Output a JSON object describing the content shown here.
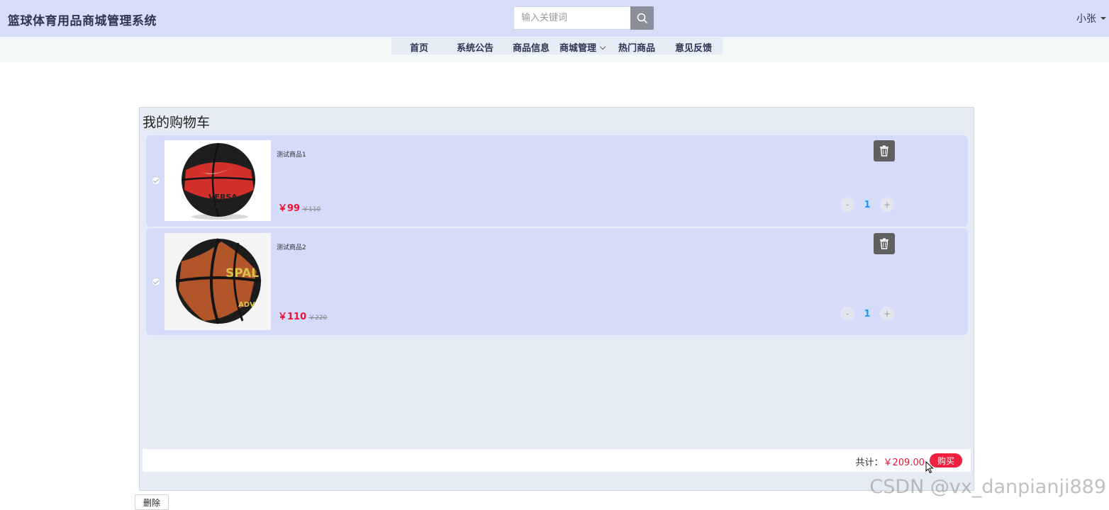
{
  "header": {
    "app_title": "篮球体育用品商城管理系统",
    "search_placeholder": "输入关键词",
    "user_name": "小张"
  },
  "nav": {
    "items": [
      {
        "label": "首页"
      },
      {
        "label": "系统公告"
      },
      {
        "label": "商品信息"
      },
      {
        "label": "商城管理"
      },
      {
        "label": "热门商品"
      },
      {
        "label": "意见反馈"
      }
    ]
  },
  "cart": {
    "title": "我的购物车",
    "items": [
      {
        "name": "测试商品1",
        "price": "￥99",
        "original_price": "￥110",
        "quantity": "1",
        "minus_label": "-",
        "plus_label": "+",
        "image_icon": "basketball-nike-icon",
        "checked": true
      },
      {
        "name": "测试商品2",
        "price": "￥110",
        "original_price": "￥220",
        "quantity": "1",
        "minus_label": "-",
        "plus_label": "+",
        "image_icon": "basketball-spalding-icon",
        "checked": true
      }
    ],
    "total_label": "共计：",
    "total_amount": "￥209.00",
    "buy_label": "购买"
  },
  "footer": {
    "delete_label": "删除"
  },
  "watermark": "CSDN @vx_danpianji889",
  "colors": {
    "header_bg": "#d6defa",
    "panel_bg": "#e6ecf6",
    "item_bg": "#d5dcf9",
    "price_red": "#ee1133",
    "qty_blue": "#2196f3",
    "buy_red": "#ee1f3f"
  }
}
